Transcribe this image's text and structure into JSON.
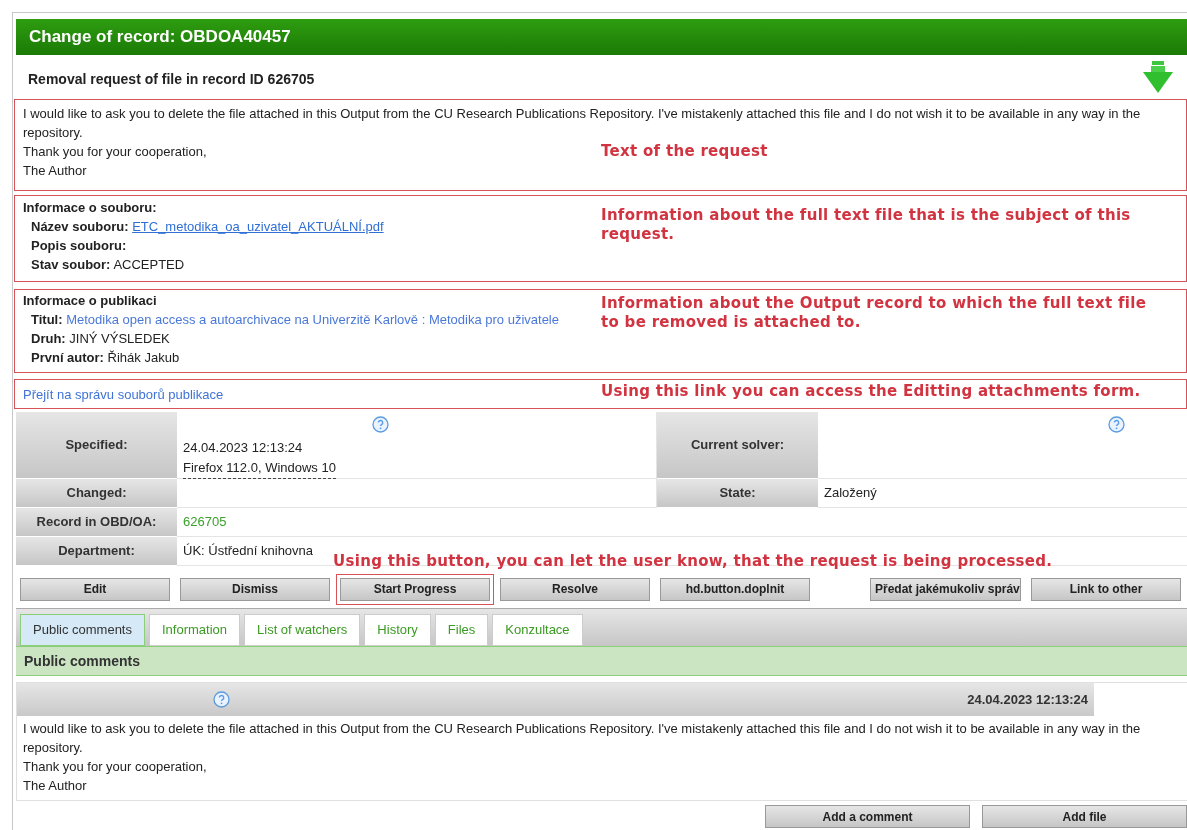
{
  "title": "Change of record: OBDOA40457",
  "subtitle": "Removal request of file in record ID 626705",
  "request": {
    "lines": [
      "I would like to ask you to delete the file attached in this Output from the CU Research Publications Repository. I've mistakenly attached this file and I do not wish it to be available in any way in the repository.",
      "Thank you for your cooperation,",
      "The Author"
    ],
    "annotation": "Text of the request"
  },
  "file_info": {
    "heading": "Informace o souboru:",
    "fields": [
      {
        "label": "Název souboru:",
        "value": "ETC_metodika_oa_uzivatel_AKTUÁLNÍ.pdf",
        "kind": "file-link"
      },
      {
        "label": "Popis souboru:"
      },
      {
        "label": "Stav soubor:",
        "value": "ACCEPTED",
        "kind": "text"
      }
    ],
    "annotation": "Information about the full text file that is the subject of this request."
  },
  "publication": {
    "heading": "Informace o publikaci",
    "fields": [
      {
        "label": "Titul:",
        "value": "Metodika open access a autoarchivace na Univerzitě Karlově : Metodika pro uživatele",
        "kind": "link"
      },
      {
        "label": "Druh:",
        "value": "JINÝ VÝSLEDEK",
        "kind": "text"
      },
      {
        "label": "První autor:",
        "value": "Řihák Jakub",
        "kind": "text"
      }
    ],
    "annotation": "Information about the Output record to which the full text file to be removed is attached to."
  },
  "files_link": {
    "label": "Přejít na správu souborů publikace",
    "annotation": "Using this link you can access the Editting attachments form."
  },
  "details": [
    {
      "cells": [
        {
          "label": "Specified:",
          "lines": [
            "24.04.2023 12:13:24",
            "Firefox 112.0, Windows 10"
          ],
          "help": true,
          "kind": "text"
        },
        {
          "label": "Current solver:",
          "help": true
        }
      ]
    },
    {
      "cells": [
        {
          "label": "Changed:",
          "help": false
        },
        {
          "label": "State:",
          "lines": [
            "Založený"
          ],
          "help": false,
          "kind": "text"
        }
      ]
    },
    {
      "cells": [
        {
          "label": "Record in OBD/OA:",
          "lines": [
            "626705"
          ],
          "help": false,
          "kind": "link"
        }
      ]
    },
    {
      "cells": [
        {
          "label": "Department:",
          "lines": [
            "ÚK: Ústřední knihovna"
          ],
          "help": false,
          "kind": "text"
        }
      ]
    }
  ],
  "button_annotation": "Using this button, you can let the user know, that the request is being processed.",
  "actions": [
    {
      "label": "Edit",
      "highlighted": false
    },
    {
      "label": "Dismiss",
      "highlighted": false
    },
    {
      "label": "Start Progress",
      "highlighted": true
    },
    {
      "label": "Resolve",
      "highlighted": false
    },
    {
      "label": "hd.button.doplnit",
      "highlighted": false
    },
    {
      "label": "Předat jakémukoliv správ",
      "highlighted": false
    },
    {
      "label": "Link to other",
      "highlighted": false
    }
  ],
  "tabs": [
    {
      "label": "Public comments",
      "selected": true
    },
    {
      "label": "Information",
      "selected": false
    },
    {
      "label": "List of watchers",
      "selected": false
    },
    {
      "label": "History",
      "selected": false
    },
    {
      "label": "Files",
      "selected": false
    },
    {
      "label": "Konzultace",
      "selected": false
    }
  ],
  "section_title": "Public comments",
  "comment": {
    "date": "24.04.2023 12:13:24",
    "lines": [
      "I would like to ask you to delete the file attached in this Output from the CU Research Publications Repository. I've mistakenly attached this file and I do not wish it to be available in any way in the repository.",
      "Thank you for your cooperation,",
      "The Author"
    ]
  },
  "bottom_buttons": [
    "Add a comment",
    "Add file"
  ]
}
